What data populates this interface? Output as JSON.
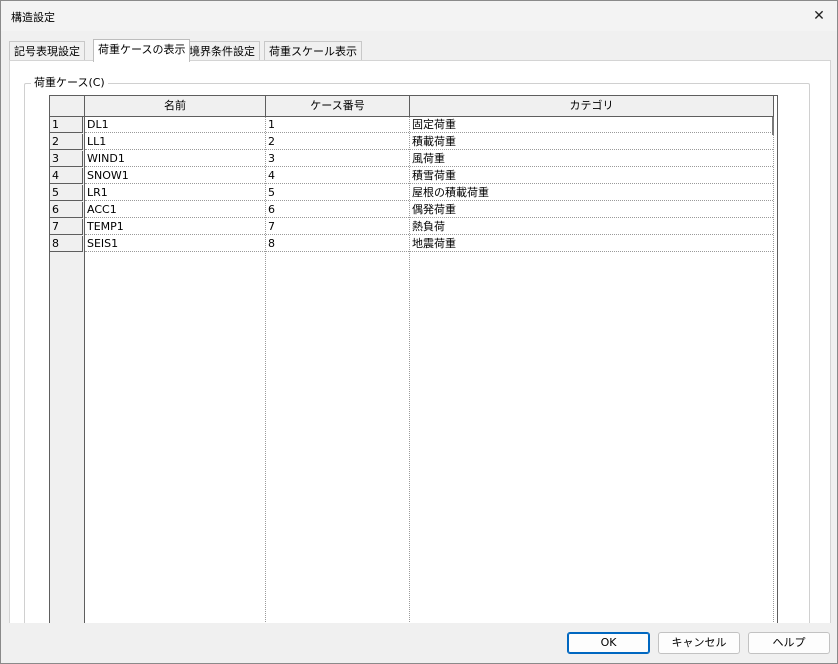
{
  "window": {
    "title": "構造設定",
    "close_glyph": "✕"
  },
  "tabs": [
    {
      "label": "記号表現設定"
    },
    {
      "label": "荷重ケースの表示",
      "active": true
    },
    {
      "label": "境界条件設定"
    },
    {
      "label": "荷重スケール表示"
    }
  ],
  "group": {
    "label": "荷重ケース(C)"
  },
  "table": {
    "columns": [
      "名前",
      "ケース番号",
      "カテゴリ"
    ],
    "rows": [
      {
        "index": "1",
        "name": "DL1",
        "case": "1",
        "category": "固定荷重"
      },
      {
        "index": "2",
        "name": "LL1",
        "case": "2",
        "category": "積載荷重"
      },
      {
        "index": "3",
        "name": "WIND1",
        "case": "3",
        "category": "風荷重"
      },
      {
        "index": "4",
        "name": "SNOW1",
        "case": "4",
        "category": "積雪荷重"
      },
      {
        "index": "5",
        "name": "LR1",
        "case": "5",
        "category": "屋根の積載荷重"
      },
      {
        "index": "6",
        "name": "ACC1",
        "case": "6",
        "category": "偶発荷重"
      },
      {
        "index": "7",
        "name": "TEMP1",
        "case": "7",
        "category": "熱負荷"
      },
      {
        "index": "8",
        "name": "SEIS1",
        "case": "8",
        "category": "地震荷重"
      }
    ]
  },
  "footer": {
    "ok": "OK",
    "cancel": "キャンセル",
    "help": "ヘルプ"
  },
  "colors": {
    "accent": "#0067c0"
  }
}
